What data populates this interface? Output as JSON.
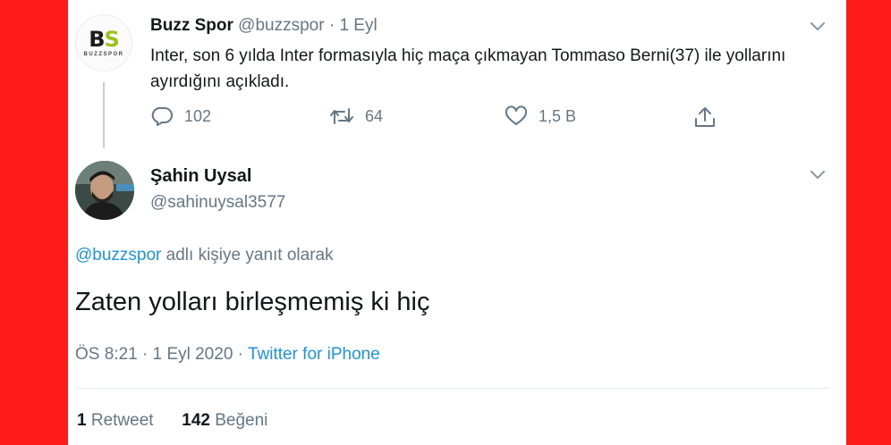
{
  "parent_tweet": {
    "avatar_main": "BS",
    "avatar_sub": "BUZZSPOR",
    "display_name": "Buzz Spor",
    "handle": "@buzzspor",
    "separator": "·",
    "time": "1 Eyl",
    "text": "Inter, son 6 yılda Inter formasıyla hiç maça çıkmayan Tommaso Berni(37) ile yollarını ayırdığını açıkladı.",
    "actions": {
      "reply_count": "102",
      "retweet_count": "64",
      "like_count": "1,5 B"
    }
  },
  "reply_tweet": {
    "display_name": "Şahin Uysal",
    "handle": "@sahinuysal3577",
    "replying_mention": "@buzzspor",
    "replying_suffix": "adlı kişiye yanıt olarak",
    "text": "Zaten yolları birleşmemiş ki hiç",
    "timestamp": "ÖS 8:21 · 1 Eyl 2020 ·",
    "source": "Twitter for iPhone",
    "retweets_count": "1",
    "retweets_label": "Retweet",
    "likes_count": "142",
    "likes_label": "Beğeni"
  },
  "icons": [
    "chevron-down-icon",
    "reply-icon",
    "retweet-icon",
    "like-icon",
    "share-icon"
  ],
  "colors": {
    "frame": "#ff1a1a",
    "link": "#1b95e0",
    "muted": "#657786",
    "text": "#14171a"
  }
}
